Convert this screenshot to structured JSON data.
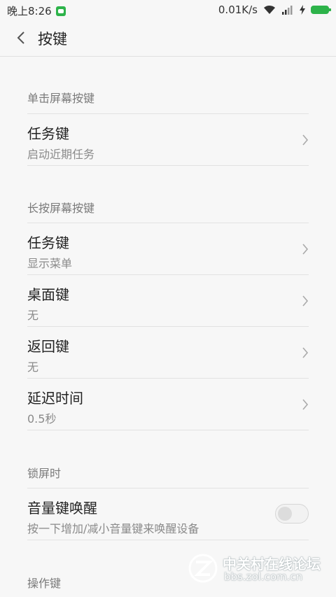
{
  "status_bar": {
    "time": "晚上8:26",
    "speed": "0.01K/s",
    "icons": [
      "wechat-icon",
      "wifi-icon",
      "signal-icon",
      "charging-icon",
      "battery-icon"
    ],
    "accent": "#2db34a"
  },
  "header": {
    "title": "按键"
  },
  "sections": [
    {
      "header": "单击屏幕按键",
      "items": [
        {
          "title": "任务键",
          "subtitle": "启动近期任务"
        }
      ]
    },
    {
      "header": "长按屏幕按键",
      "items": [
        {
          "title": "任务键",
          "subtitle": "显示菜单"
        },
        {
          "title": "桌面键",
          "subtitle": "无"
        },
        {
          "title": "返回键",
          "subtitle": "无"
        },
        {
          "title": "延迟时间",
          "subtitle": "0.5秒"
        }
      ]
    },
    {
      "header": "锁屏时",
      "items": [
        {
          "title": "音量键唤醒",
          "subtitle": "按一下增加/减小音量键来唤醒设备",
          "toggle_on": false
        }
      ]
    },
    {
      "header": "操作键",
      "items": []
    }
  ],
  "watermark": {
    "title": "中关村在线论坛",
    "subtitle": "bbs.zol.com.cn"
  }
}
